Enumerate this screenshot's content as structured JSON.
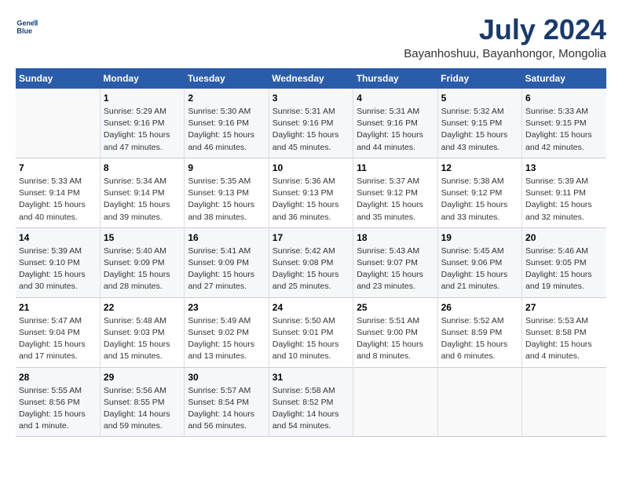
{
  "header": {
    "logo_line1": "General",
    "logo_line2": "Blue",
    "month_year": "July 2024",
    "location": "Bayanhoshuu, Bayanhongor, Mongolia"
  },
  "calendar": {
    "weekdays": [
      "Sunday",
      "Monday",
      "Tuesday",
      "Wednesday",
      "Thursday",
      "Friday",
      "Saturday"
    ],
    "weeks": [
      [
        {
          "day": "",
          "info": ""
        },
        {
          "day": "1",
          "info": "Sunrise: 5:29 AM\nSunset: 9:16 PM\nDaylight: 15 hours\nand 47 minutes."
        },
        {
          "day": "2",
          "info": "Sunrise: 5:30 AM\nSunset: 9:16 PM\nDaylight: 15 hours\nand 46 minutes."
        },
        {
          "day": "3",
          "info": "Sunrise: 5:31 AM\nSunset: 9:16 PM\nDaylight: 15 hours\nand 45 minutes."
        },
        {
          "day": "4",
          "info": "Sunrise: 5:31 AM\nSunset: 9:16 PM\nDaylight: 15 hours\nand 44 minutes."
        },
        {
          "day": "5",
          "info": "Sunrise: 5:32 AM\nSunset: 9:15 PM\nDaylight: 15 hours\nand 43 minutes."
        },
        {
          "day": "6",
          "info": "Sunrise: 5:33 AM\nSunset: 9:15 PM\nDaylight: 15 hours\nand 42 minutes."
        }
      ],
      [
        {
          "day": "7",
          "info": "Sunrise: 5:33 AM\nSunset: 9:14 PM\nDaylight: 15 hours\nand 40 minutes."
        },
        {
          "day": "8",
          "info": "Sunrise: 5:34 AM\nSunset: 9:14 PM\nDaylight: 15 hours\nand 39 minutes."
        },
        {
          "day": "9",
          "info": "Sunrise: 5:35 AM\nSunset: 9:13 PM\nDaylight: 15 hours\nand 38 minutes."
        },
        {
          "day": "10",
          "info": "Sunrise: 5:36 AM\nSunset: 9:13 PM\nDaylight: 15 hours\nand 36 minutes."
        },
        {
          "day": "11",
          "info": "Sunrise: 5:37 AM\nSunset: 9:12 PM\nDaylight: 15 hours\nand 35 minutes."
        },
        {
          "day": "12",
          "info": "Sunrise: 5:38 AM\nSunset: 9:12 PM\nDaylight: 15 hours\nand 33 minutes."
        },
        {
          "day": "13",
          "info": "Sunrise: 5:39 AM\nSunset: 9:11 PM\nDaylight: 15 hours\nand 32 minutes."
        }
      ],
      [
        {
          "day": "14",
          "info": "Sunrise: 5:39 AM\nSunset: 9:10 PM\nDaylight: 15 hours\nand 30 minutes."
        },
        {
          "day": "15",
          "info": "Sunrise: 5:40 AM\nSunset: 9:09 PM\nDaylight: 15 hours\nand 28 minutes."
        },
        {
          "day": "16",
          "info": "Sunrise: 5:41 AM\nSunset: 9:09 PM\nDaylight: 15 hours\nand 27 minutes."
        },
        {
          "day": "17",
          "info": "Sunrise: 5:42 AM\nSunset: 9:08 PM\nDaylight: 15 hours\nand 25 minutes."
        },
        {
          "day": "18",
          "info": "Sunrise: 5:43 AM\nSunset: 9:07 PM\nDaylight: 15 hours\nand 23 minutes."
        },
        {
          "day": "19",
          "info": "Sunrise: 5:45 AM\nSunset: 9:06 PM\nDaylight: 15 hours\nand 21 minutes."
        },
        {
          "day": "20",
          "info": "Sunrise: 5:46 AM\nSunset: 9:05 PM\nDaylight: 15 hours\nand 19 minutes."
        }
      ],
      [
        {
          "day": "21",
          "info": "Sunrise: 5:47 AM\nSunset: 9:04 PM\nDaylight: 15 hours\nand 17 minutes."
        },
        {
          "day": "22",
          "info": "Sunrise: 5:48 AM\nSunset: 9:03 PM\nDaylight: 15 hours\nand 15 minutes."
        },
        {
          "day": "23",
          "info": "Sunrise: 5:49 AM\nSunset: 9:02 PM\nDaylight: 15 hours\nand 13 minutes."
        },
        {
          "day": "24",
          "info": "Sunrise: 5:50 AM\nSunset: 9:01 PM\nDaylight: 15 hours\nand 10 minutes."
        },
        {
          "day": "25",
          "info": "Sunrise: 5:51 AM\nSunset: 9:00 PM\nDaylight: 15 hours\nand 8 minutes."
        },
        {
          "day": "26",
          "info": "Sunrise: 5:52 AM\nSunset: 8:59 PM\nDaylight: 15 hours\nand 6 minutes."
        },
        {
          "day": "27",
          "info": "Sunrise: 5:53 AM\nSunset: 8:58 PM\nDaylight: 15 hours\nand 4 minutes."
        }
      ],
      [
        {
          "day": "28",
          "info": "Sunrise: 5:55 AM\nSunset: 8:56 PM\nDaylight: 15 hours\nand 1 minute."
        },
        {
          "day": "29",
          "info": "Sunrise: 5:56 AM\nSunset: 8:55 PM\nDaylight: 14 hours\nand 59 minutes."
        },
        {
          "day": "30",
          "info": "Sunrise: 5:57 AM\nSunset: 8:54 PM\nDaylight: 14 hours\nand 56 minutes."
        },
        {
          "day": "31",
          "info": "Sunrise: 5:58 AM\nSunset: 8:52 PM\nDaylight: 14 hours\nand 54 minutes."
        },
        {
          "day": "",
          "info": ""
        },
        {
          "day": "",
          "info": ""
        },
        {
          "day": "",
          "info": ""
        }
      ]
    ]
  }
}
